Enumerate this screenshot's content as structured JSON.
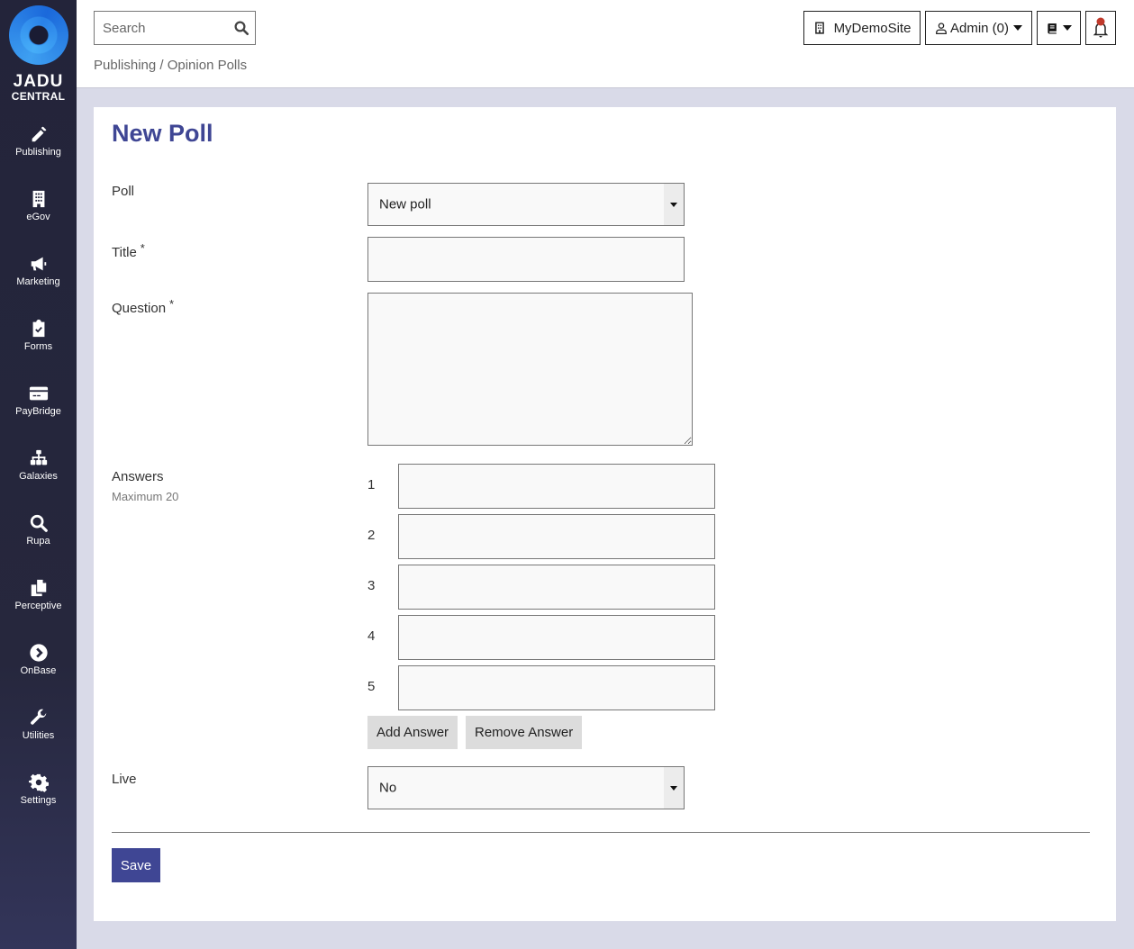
{
  "brand": {
    "line1": "JADU",
    "line2": "CENTRAL"
  },
  "sidebar": {
    "items": [
      {
        "label": "Publishing",
        "icon": "pencil-icon"
      },
      {
        "label": "eGov",
        "icon": "building-icon"
      },
      {
        "label": "Marketing",
        "icon": "megaphone-icon"
      },
      {
        "label": "Forms",
        "icon": "clipboard-check-icon"
      },
      {
        "label": "PayBridge",
        "icon": "credit-card-icon"
      },
      {
        "label": "Galaxies",
        "icon": "sitemap-icon"
      },
      {
        "label": "Rupa",
        "icon": "search-icon"
      },
      {
        "label": "Perceptive",
        "icon": "copy-icon"
      },
      {
        "label": "OnBase",
        "icon": "chevron-circle-right-icon"
      },
      {
        "label": "Utilities",
        "icon": "wrench-icon"
      },
      {
        "label": "Settings",
        "icon": "gear-icon"
      }
    ]
  },
  "header": {
    "search_placeholder": "Search",
    "breadcrumb": "Publishing / Opinion Polls",
    "site_label": "MyDemoSite",
    "user_label": "Admin (0)",
    "notification_color": "#c0392b"
  },
  "form": {
    "title": "New Poll",
    "poll_label": "Poll",
    "poll_selected": "New poll",
    "title_label": "Title",
    "title_value": "",
    "question_label": "Question",
    "question_value": "",
    "required_marker": "*",
    "answers_label": "Answers",
    "answers_hint": "Maximum 20",
    "answers": [
      {
        "num": "1",
        "value": ""
      },
      {
        "num": "2",
        "value": ""
      },
      {
        "num": "3",
        "value": ""
      },
      {
        "num": "4",
        "value": ""
      },
      {
        "num": "5",
        "value": ""
      }
    ],
    "add_answer": "Add Answer",
    "remove_answer": "Remove Answer",
    "live_label": "Live",
    "live_selected": "No",
    "save": "Save"
  },
  "colors": {
    "accent": "#3f4694",
    "sidebar": "#23243a",
    "page_bg": "#d9dae8"
  }
}
